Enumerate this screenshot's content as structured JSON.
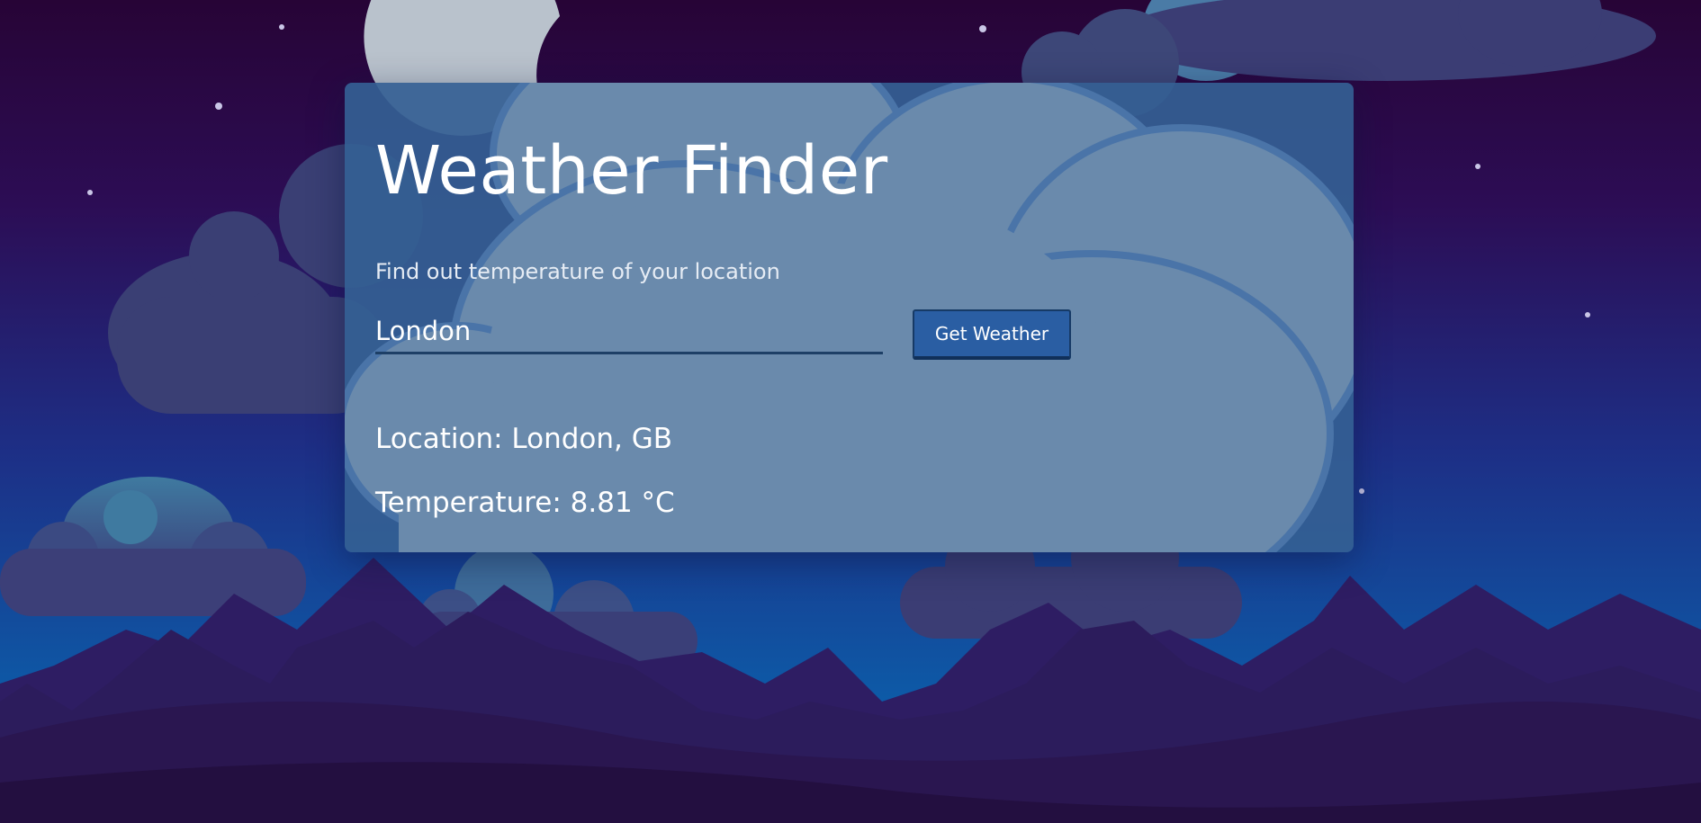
{
  "app": {
    "title": "Weather Finder",
    "subtitle": "Find out temperature of your location"
  },
  "search": {
    "value": "London",
    "placeholder": "",
    "button_label": "Get Weather"
  },
  "result": {
    "location": "Location: London, GB",
    "temperature": "Temperature: 8.81 °C"
  },
  "colors": {
    "sky_top": "#2a0a3a",
    "sky_mid": "#2b1060",
    "sky_bottom": "#0e5aa6",
    "card": "#346094",
    "button": "#2a5ea3"
  },
  "icons": [
    "moon-illustration",
    "cloud-illustration",
    "mountain-illustration",
    "star-dots"
  ]
}
